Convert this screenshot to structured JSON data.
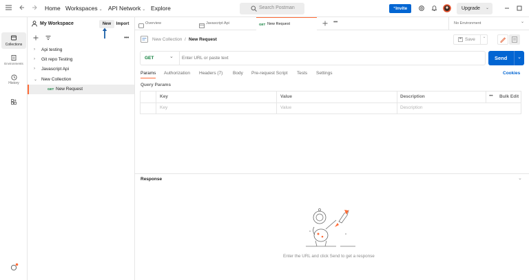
{
  "topbar": {
    "home": "Home",
    "workspaces": "Workspaces",
    "api_network": "API Network",
    "explore": "Explore",
    "search_placeholder": "Search Postman",
    "invite": "Invite",
    "upgrade": "Upgrade"
  },
  "rail": {
    "collections": "Collections",
    "environments": "Environments",
    "history": "History"
  },
  "sidebar": {
    "workspace_name": "My Workspace",
    "new_button": "New",
    "import_button": "Import",
    "items": [
      {
        "label": "Api testing"
      },
      {
        "label": "Git repo Testing"
      },
      {
        "label": "Javascript Api"
      },
      {
        "label": "New Collection"
      }
    ],
    "request": {
      "method": "GET",
      "label": "New Request"
    }
  },
  "tabs": {
    "items": [
      {
        "label": "Overview"
      },
      {
        "label": "Javascript Api"
      },
      {
        "method": "GET",
        "label": "New Request"
      }
    ],
    "environment": "No Environment"
  },
  "request": {
    "breadcrumb_collection": "New Collection",
    "breadcrumb_sep": "/",
    "breadcrumb_request": "New Request",
    "save": "Save",
    "method": "GET",
    "url_placeholder": "Enter URL or paste text",
    "send": "Send",
    "subtabs": [
      "Params",
      "Authorization",
      "Headers (7)",
      "Body",
      "Pre-request Script",
      "Tests",
      "Settings"
    ],
    "cookies": "Cookies",
    "query_params_title": "Query Params",
    "columns": [
      "Key",
      "Value",
      "Description"
    ],
    "bulk_edit": "Bulk Edit",
    "row_placeholders": [
      "Key",
      "Value",
      "Description"
    ]
  },
  "response": {
    "title": "Response",
    "hint": "Enter the URL and click Send to get a response"
  },
  "colors": {
    "accent": "#ff6c37",
    "primary": "#0265d2",
    "get": "#0c7d39",
    "annotation_arrow": "#1a5fa8"
  }
}
